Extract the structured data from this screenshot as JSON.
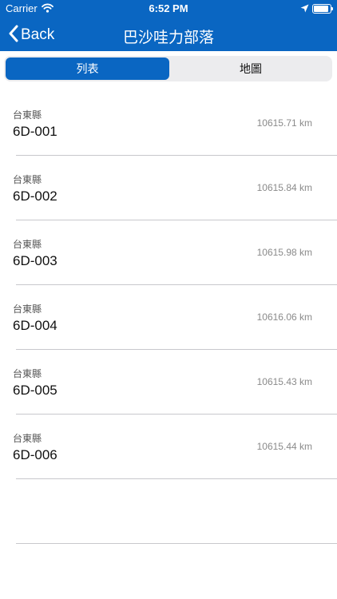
{
  "status_bar": {
    "carrier": "Carrier",
    "time": "6:52 PM"
  },
  "nav": {
    "back_label": "Back",
    "title": "巴沙哇力部落"
  },
  "segments": {
    "list_label": "列表",
    "map_label": "地圖",
    "selected": "列表"
  },
  "colors": {
    "accent": "#0a66c2",
    "segment_bg": "#ececee",
    "separator": "#c8c8cc"
  },
  "rows": [
    {
      "county": "台東縣",
      "code": "6D-001",
      "distance": "10615.71 km"
    },
    {
      "county": "台東縣",
      "code": "6D-002",
      "distance": "10615.84 km"
    },
    {
      "county": "台東縣",
      "code": "6D-003",
      "distance": "10615.98 km"
    },
    {
      "county": "台東縣",
      "code": "6D-004",
      "distance": "10616.06 km"
    },
    {
      "county": "台東縣",
      "code": "6D-005",
      "distance": "10615.43 km"
    },
    {
      "county": "台東縣",
      "code": "6D-006",
      "distance": "10615.44 km"
    }
  ]
}
